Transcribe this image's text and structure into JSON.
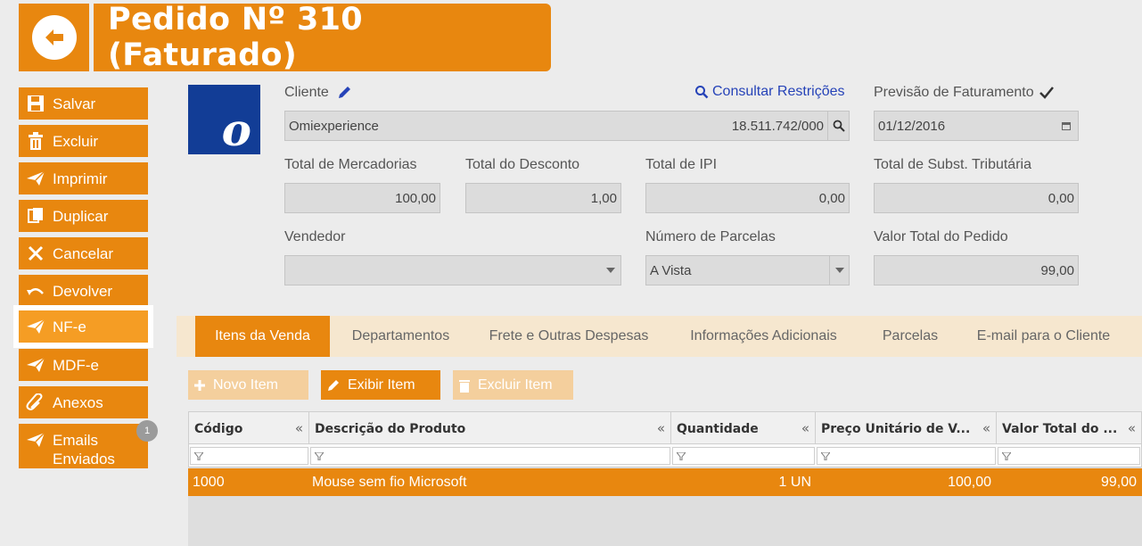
{
  "header": {
    "title": "Pedido Nº 310 (Faturado)"
  },
  "sidebar": [
    {
      "label": "Salvar",
      "icon": "save-icon"
    },
    {
      "label": "Excluir",
      "icon": "trash-icon"
    },
    {
      "label": "Imprimir",
      "icon": "send-icon"
    },
    {
      "label": "Duplicar",
      "icon": "copy-icon"
    },
    {
      "label": "Cancelar",
      "icon": "x-icon"
    },
    {
      "label": "Devolver",
      "icon": "undo-icon"
    },
    {
      "label": "NF-e",
      "icon": "send-icon"
    },
    {
      "label": "MDF-e",
      "icon": "send-icon"
    },
    {
      "label": "Anexos",
      "icon": "paperclip-icon"
    },
    {
      "label": "Emails Enviados",
      "icon": "send-icon",
      "badge": "1"
    }
  ],
  "logo": {
    "letter": "o"
  },
  "form": {
    "cliente_label": "Cliente",
    "consultar_link": "Consultar Restrições",
    "cliente_name": "Omiexperience",
    "cliente_doc": "18.511.742/000",
    "previsao_label": "Previsão de Faturamento",
    "previsao_value": "01/12/2016",
    "total_merc_label": "Total de Mercadorias",
    "total_merc_value": "100,00",
    "total_desc_label": "Total do Desconto",
    "total_desc_value": "1,00",
    "total_ipi_label": "Total de IPI",
    "total_ipi_value": "0,00",
    "total_st_label": "Total de Subst. Tributária",
    "total_st_value": "0,00",
    "vendedor_label": "Vendedor",
    "vendedor_value": "",
    "parcelas_label": "Número de Parcelas",
    "parcelas_value": "A Vista",
    "valor_total_label": "Valor Total do Pedido",
    "valor_total_value": "99,00"
  },
  "tabs": [
    "Itens da Venda",
    "Departamentos",
    "Frete e Outras Despesas",
    "Informações Adicionais",
    "Parcelas",
    "E-mail para o Cliente"
  ],
  "toolbar": {
    "novo": "Novo Item",
    "exibir": "Exibir Item",
    "excluir": "Excluir Item"
  },
  "grid": {
    "columns": [
      "Código",
      "Descrição do Produto",
      "Quantidade",
      "Preço Unitário de V...",
      "Valor Total do ..."
    ],
    "rows": [
      {
        "codigo": "1000",
        "descricao": "Mouse sem fio Microsoft",
        "quantidade": "1 UN",
        "preco": "100,00",
        "total": "99,00"
      }
    ]
  },
  "colors": {
    "accent": "#e8870f",
    "accent_light": "#f59d24",
    "link": "#2643b8",
    "logo_bg": "#123d96"
  }
}
